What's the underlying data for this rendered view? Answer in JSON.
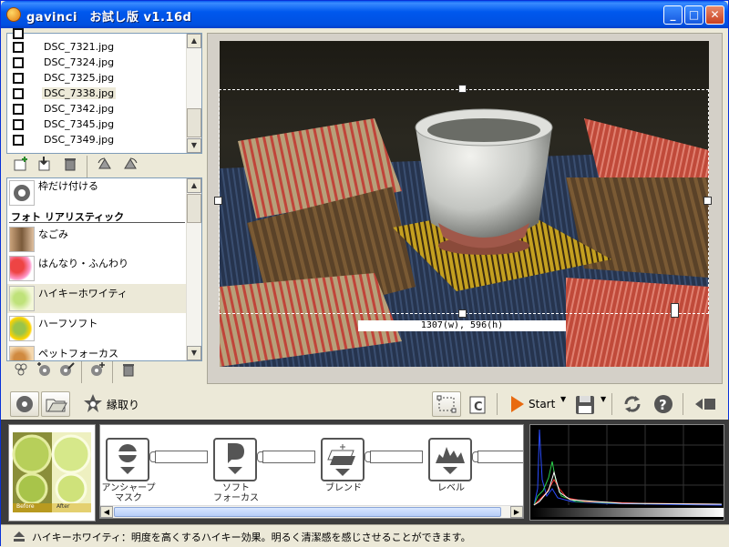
{
  "window": {
    "title": "gavinci　お試し版 v1.16d",
    "minimize": "_",
    "maximize": "□",
    "close": "✕"
  },
  "file_list": {
    "files": [
      {
        "name": "DSC_7321.jpg",
        "selected": false
      },
      {
        "name": "DSC_7324.jpg",
        "selected": false
      },
      {
        "name": "DSC_7325.jpg",
        "selected": false
      },
      {
        "name": "DSC_7338.jpg",
        "selected": true
      },
      {
        "name": "DSC_7342.jpg",
        "selected": false
      },
      {
        "name": "DSC_7345.jpg",
        "selected": false
      },
      {
        "name": "DSC_7349.jpg",
        "selected": false
      }
    ],
    "tools": [
      "add-file-icon",
      "import-icon",
      "trash-icon",
      "rotate-left-icon",
      "rotate-right-icon"
    ]
  },
  "effects": {
    "frame_item": "枠だけ付ける",
    "category": "フォト リアリスティック",
    "items": [
      {
        "label": "なごみ",
        "selected": false
      },
      {
        "label": "はんなり・ふんわり",
        "selected": false
      },
      {
        "label": "ハイキーホワイティ",
        "selected": true
      },
      {
        "label": "ハーフソフト",
        "selected": false
      },
      {
        "label": "ペットフォーカス",
        "selected": false
      }
    ],
    "tools": [
      "group-icon",
      "effect-add-icon",
      "effect-edit-icon",
      "effect-new-icon",
      "trash-icon"
    ]
  },
  "image": {
    "size_label": "1307(w), 596(h)"
  },
  "toolbar": {
    "border_label": "縁取り",
    "start_label": "Start"
  },
  "chain": {
    "nodes": [
      {
        "label": "アンシャープ\nマスク",
        "icon": "unsharp-mask-icon"
      },
      {
        "label": "ソフト\nフォーカス",
        "icon": "soft-focus-icon"
      },
      {
        "label": "ブレンド",
        "icon": "blend-icon"
      },
      {
        "label": "レベル",
        "icon": "levels-icon"
      }
    ]
  },
  "thumbnail": {
    "left_caption": "Before",
    "right_caption": "After"
  },
  "status": {
    "text": "ハイキーホワイティ：明度を高くするハイキー効果。明るく清潔感を感じさせることができます。"
  },
  "colors": {
    "titlebar": "#0058ee",
    "panel_bg": "#ece9d8",
    "bottom_bg": "#3c3c3c",
    "accent_orange": "#e86a10"
  }
}
